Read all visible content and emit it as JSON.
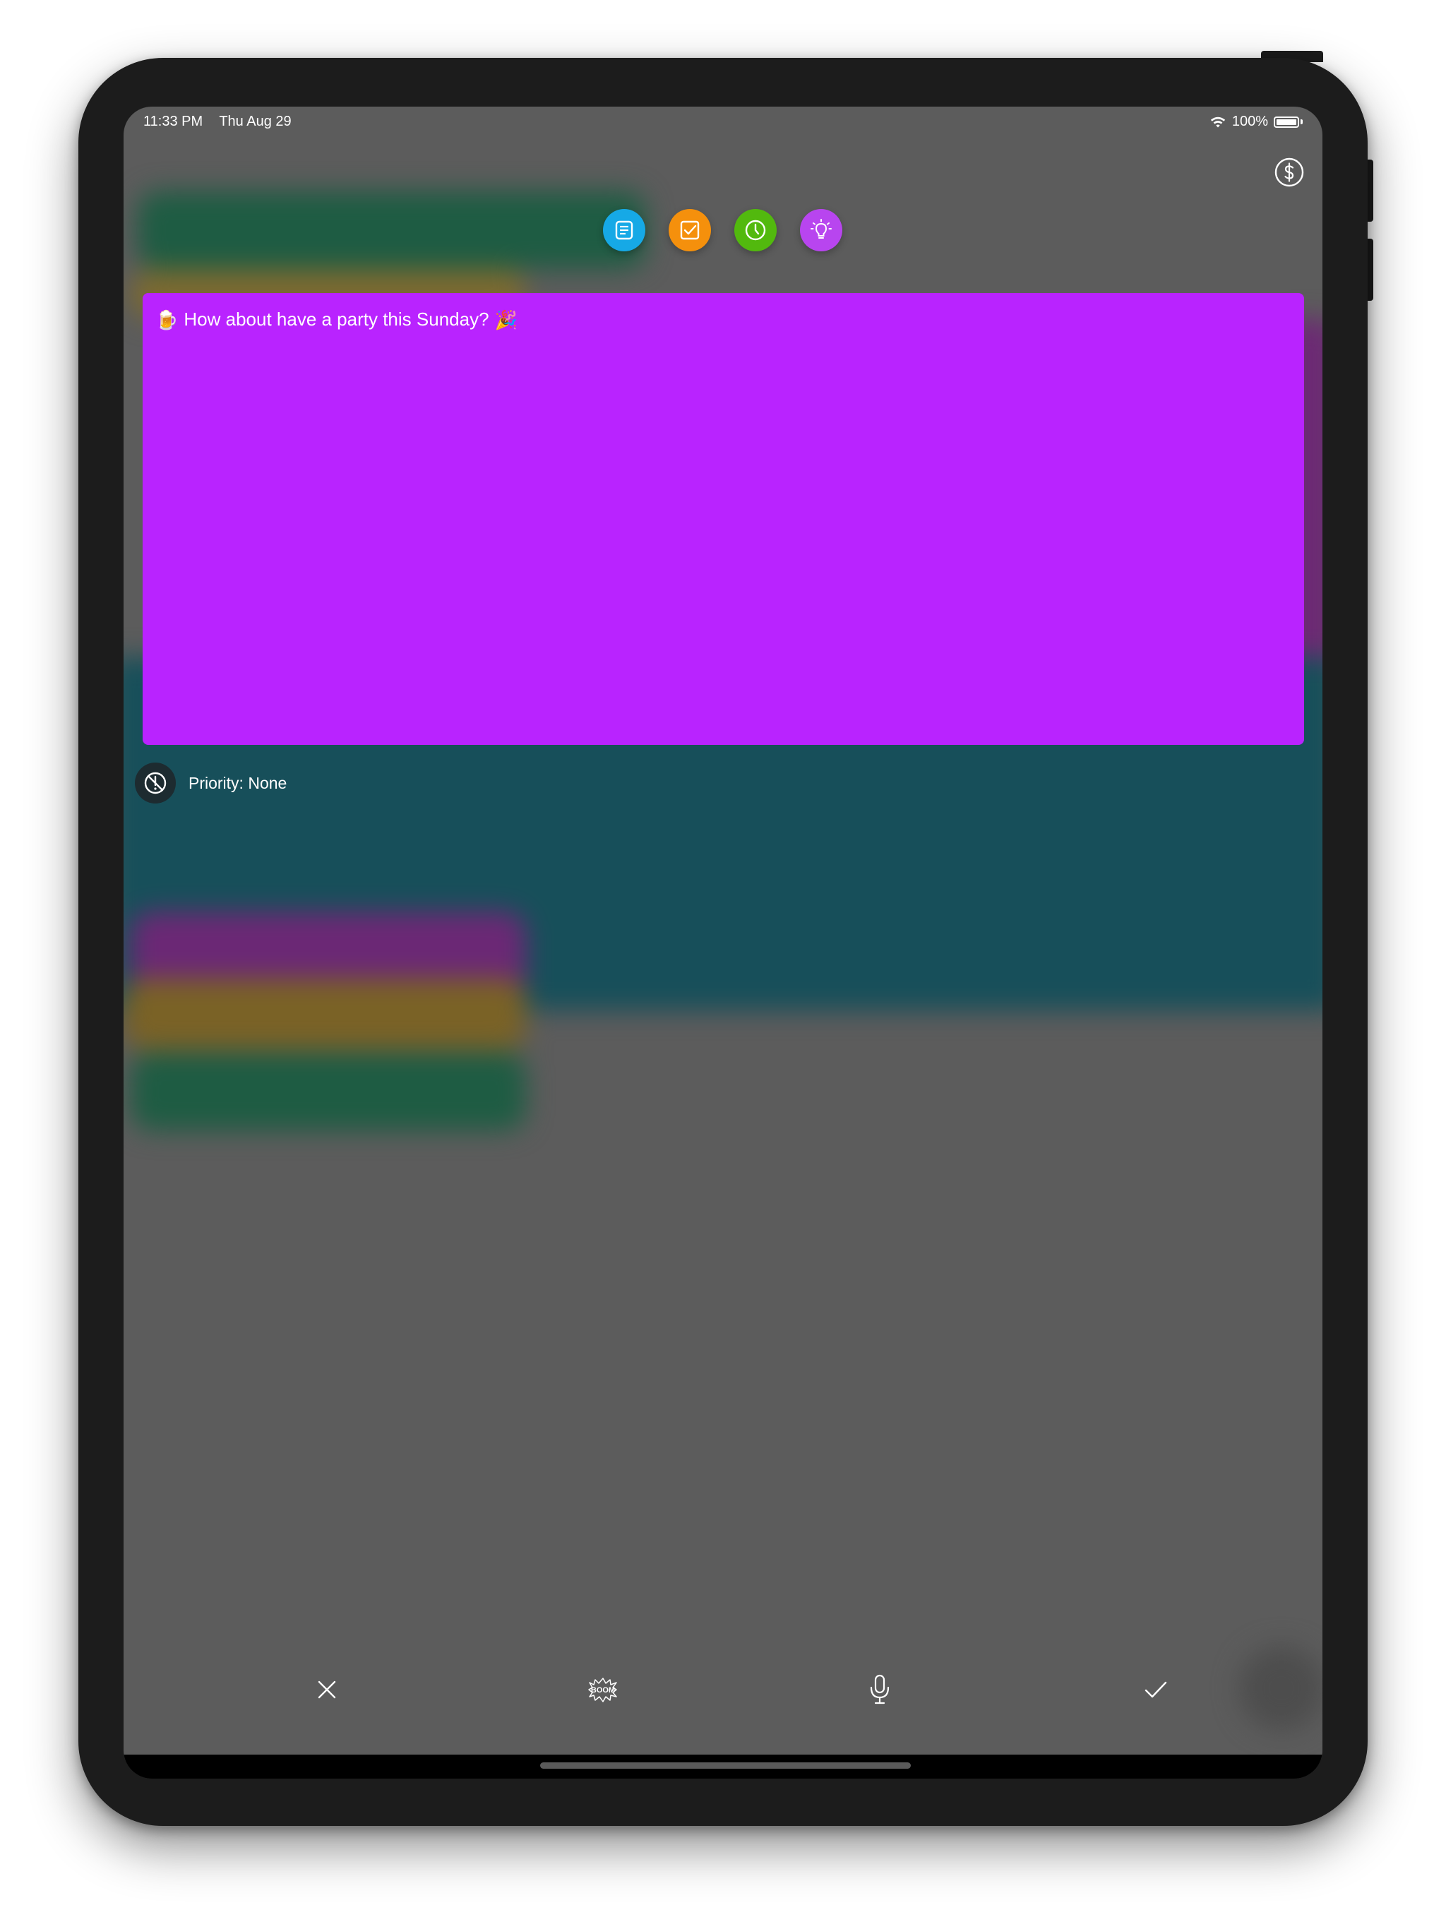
{
  "status_bar": {
    "time": "11:33 PM",
    "date": "Thu Aug 29",
    "battery": "100%",
    "wifi_icon": "wifi-icon",
    "battery_icon": "battery-icon"
  },
  "toolbar": {
    "dollar_icon": "dollar-circle-icon",
    "note_types": [
      {
        "name": "note",
        "icon": "document-icon",
        "color": "#16a9e6"
      },
      {
        "name": "todo",
        "icon": "checkbox-icon",
        "color": "#f5900c"
      },
      {
        "name": "reminder",
        "icon": "clock-icon",
        "color": "#52b90e"
      },
      {
        "name": "idea",
        "icon": "lightbulb-icon",
        "color": "#b845ef"
      }
    ]
  },
  "note": {
    "leading_emoji": "🍺",
    "text": "How about have a party this Sunday?",
    "trailing_emoji": "🎉",
    "color": "#b923ff"
  },
  "priority": {
    "label": "Priority: None",
    "icon": "priority-none-icon"
  },
  "bottom_bar": {
    "cancel_icon": "close-icon",
    "boom_icon": "boom-icon",
    "boom_text": "BOOM",
    "mic_icon": "microphone-icon",
    "confirm_icon": "checkmark-icon"
  }
}
